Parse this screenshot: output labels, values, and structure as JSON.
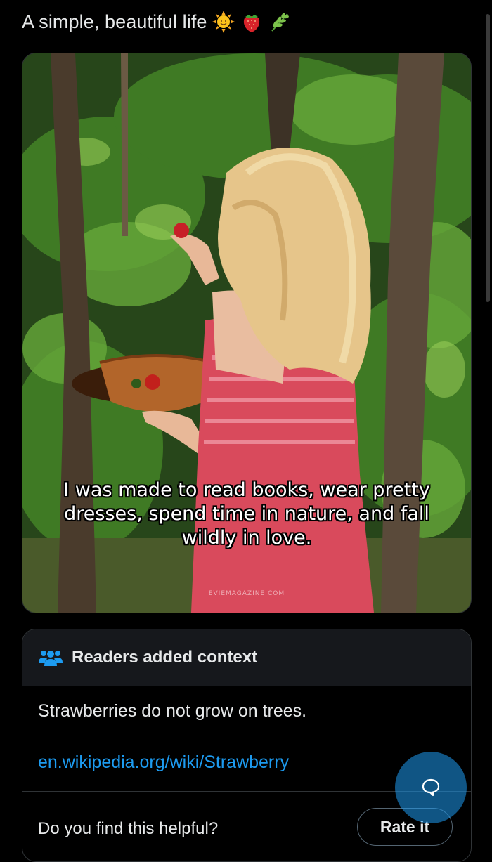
{
  "post": {
    "text": "A simple, beautiful life",
    "emojis": [
      "sun-emoji",
      "strawberry-emoji",
      "herb-emoji"
    ]
  },
  "media": {
    "caption_lines": [
      "I was made to read books, wear pretty",
      "dresses, spend time in nature, and fall",
      "wildly in love."
    ],
    "watermark": "EVIEMAGAZINE.COM"
  },
  "community_note": {
    "title": "Readers added context",
    "body": "Strawberries do not grow on trees.",
    "link": "en.wikipedia.org/wiki/Strawberry",
    "helpful_prompt": "Do you find this helpful?",
    "rate_button": "Rate it"
  },
  "colors": {
    "background": "#000000",
    "link": "#1d9bf0",
    "fab": "#1d9bf0",
    "note_header": "#16181c"
  },
  "icons": {
    "note_icon": "people-icon",
    "fab_icon": "chat-bubble-icon"
  }
}
